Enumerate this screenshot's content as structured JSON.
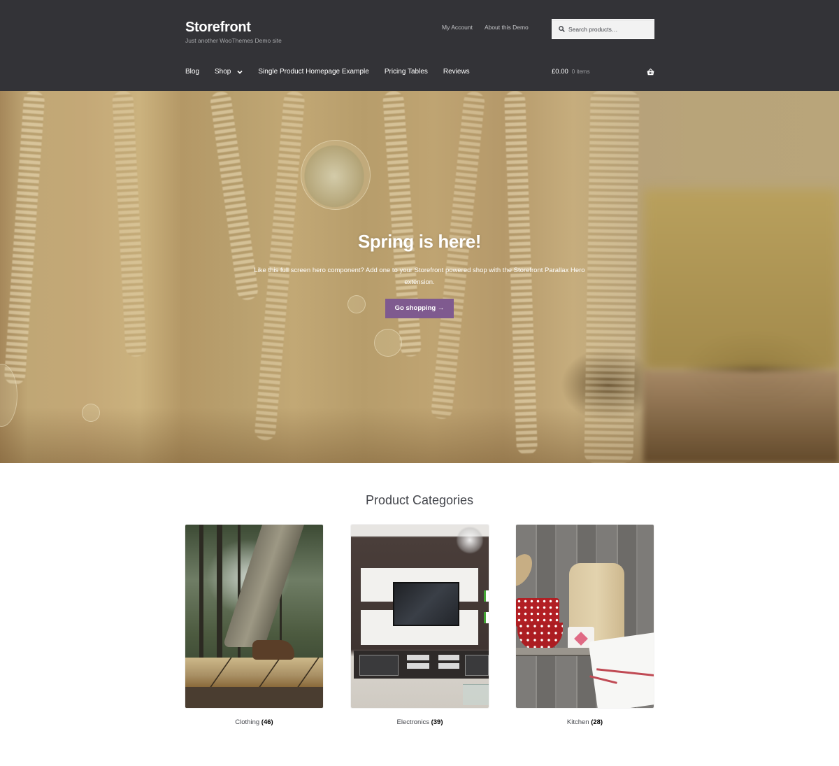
{
  "header": {
    "site_title": "Storefront",
    "site_description": "Just another WooThemes Demo site",
    "secondary_nav": [
      {
        "label": "My Account"
      },
      {
        "label": "About this Demo"
      }
    ],
    "search": {
      "placeholder": "Search products…",
      "value": "",
      "icon": "search-icon"
    },
    "primary_nav": [
      {
        "label": "Blog"
      },
      {
        "label": "Shop",
        "has_dropdown": true
      },
      {
        "label": "Single Product Homepage Example"
      },
      {
        "label": "Pricing Tables"
      },
      {
        "label": "Reviews"
      }
    ],
    "cart": {
      "amount": "£0.00",
      "count": "0 items",
      "icon": "basket-icon"
    }
  },
  "hero": {
    "title": "Spring is here!",
    "text": "Like this full screen hero component? Add one to your Storefront powered shop with the Storefront Parallax Hero extension.",
    "button_label": "Go shopping →",
    "button_color": "#7f5a8f"
  },
  "categories": {
    "title": "Product Categories",
    "items": [
      {
        "name": "Clothing",
        "count": "(46)"
      },
      {
        "name": "Electronics",
        "count": "(39)"
      },
      {
        "name": "Kitchen",
        "count": "(28)"
      }
    ]
  },
  "colors": {
    "header_bg": "#333337",
    "accent": "#7f5a8f",
    "body_text": "#43454b"
  }
}
